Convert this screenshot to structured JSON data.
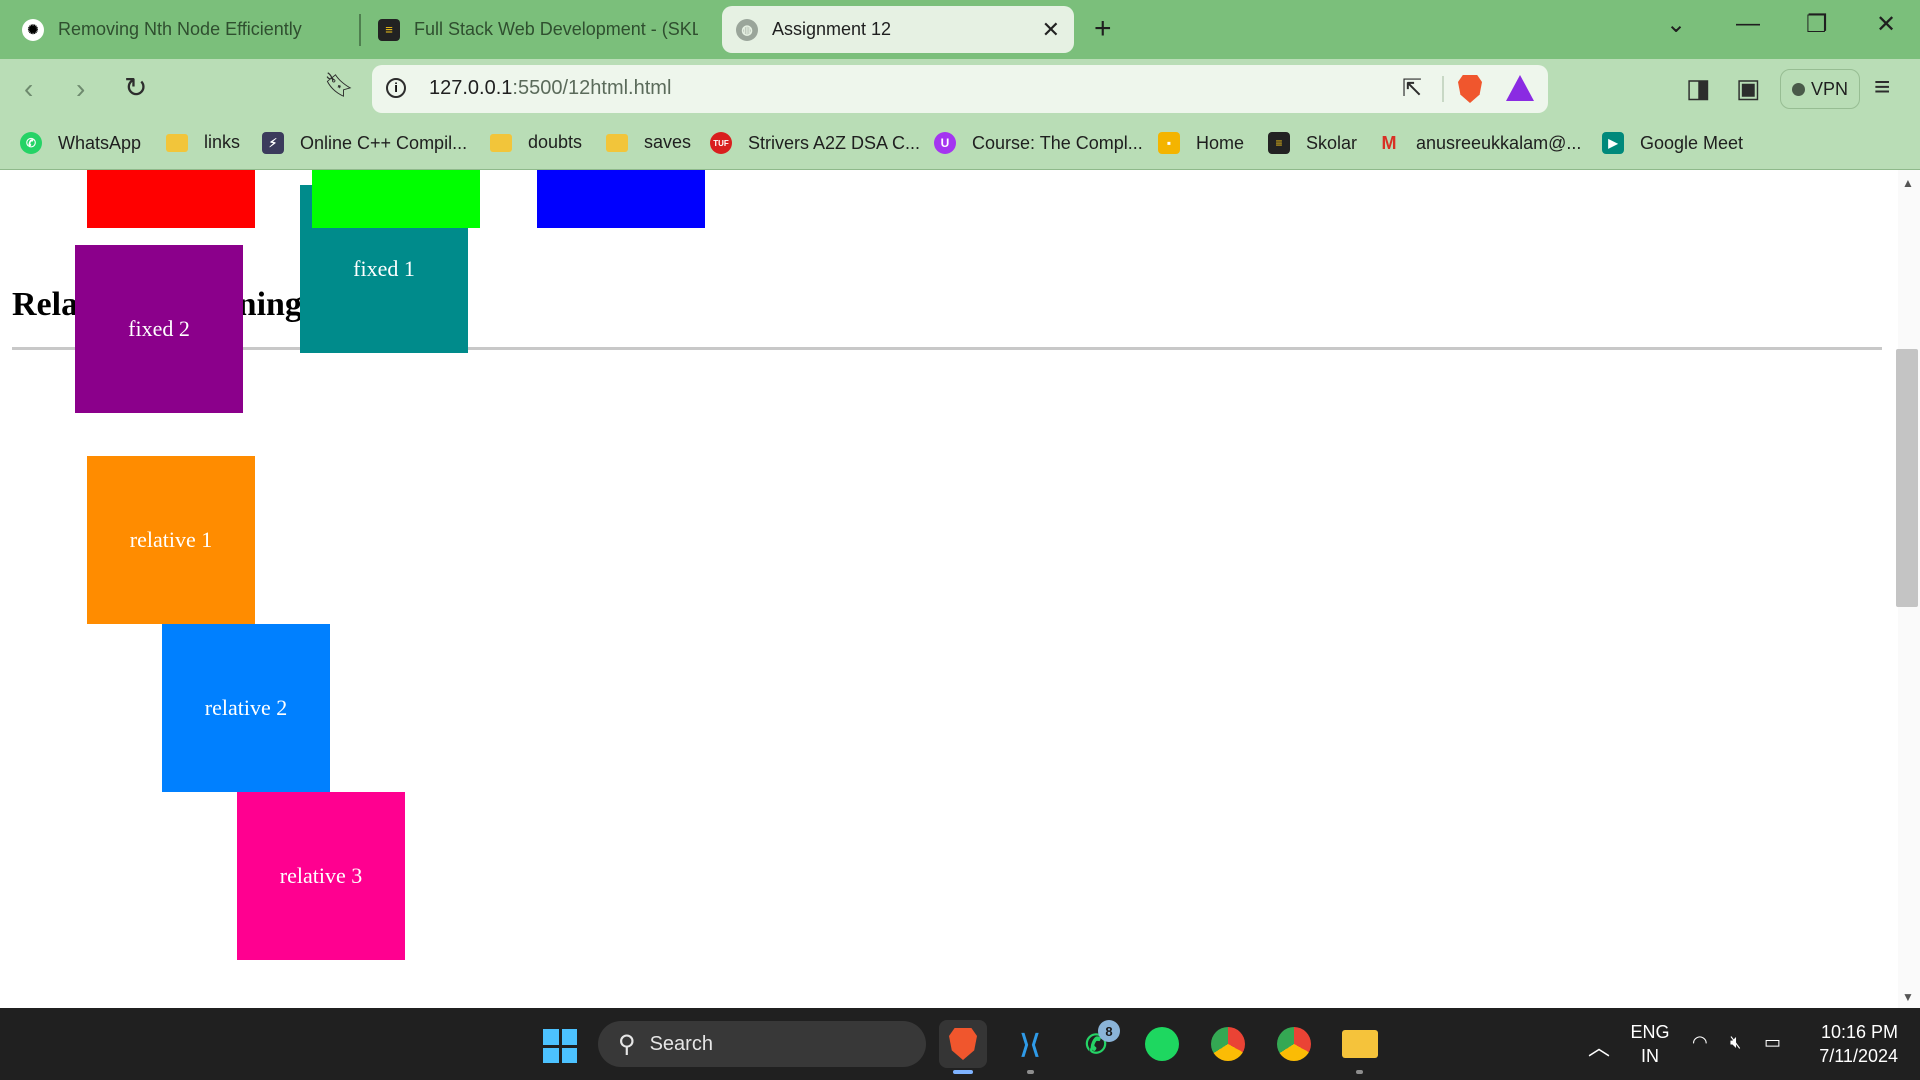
{
  "browser": {
    "tabs": [
      {
        "title": "Removing Nth Node Efficiently",
        "active": false,
        "icon": "chatgpt-icon"
      },
      {
        "title": "Full Stack Web Development - (SKLR",
        "active": false,
        "icon": "skolar-icon"
      },
      {
        "title": "Assignment 12",
        "active": true,
        "icon": "globe-icon"
      }
    ],
    "new_tab_label": "+",
    "url_host": "127.0.0.1",
    "url_path": ":5500/12html.html",
    "vpn_label": "VPN",
    "bookmarks": [
      {
        "label": "WhatsApp",
        "icon": "whatsapp-icon"
      },
      {
        "label": "links",
        "icon": "folder-icon"
      },
      {
        "label": "Online C++ Compil...",
        "icon": "bolt-icon"
      },
      {
        "label": "doubts",
        "icon": "folder-icon"
      },
      {
        "label": "saves",
        "icon": "folder-icon"
      },
      {
        "label": "Strivers A2Z DSA C...",
        "icon": "tuf-icon"
      },
      {
        "label": "Course: The Compl...",
        "icon": "udemy-icon"
      },
      {
        "label": "Home",
        "icon": "classroom-icon"
      },
      {
        "label": "Skolar",
        "icon": "skolar-icon"
      },
      {
        "label": "anusreeukkalam@...",
        "icon": "gmail-icon"
      },
      {
        "label": "Google Meet",
        "icon": "meet-icon"
      }
    ]
  },
  "page": {
    "heading": "Relative Positioning",
    "boxes": {
      "fixed_1": "fixed 1",
      "fixed_2": "fixed 2",
      "relative_1": "relative 1",
      "relative_2": "relative 2",
      "relative_3": "relative 3"
    },
    "colors": {
      "red": "#ff0000",
      "green": "#00ff00",
      "blue": "#0000ff",
      "teal": "#008b8b",
      "purple": "#8b008b",
      "orange": "#ff8c00",
      "azure": "#0080ff",
      "pink": "#ff0090"
    }
  },
  "taskbar": {
    "search_label": "Search",
    "whatsapp_badge": "8",
    "language_top": "ENG",
    "language_bottom": "IN",
    "time": "10:16 PM",
    "date": "7/11/2024"
  }
}
